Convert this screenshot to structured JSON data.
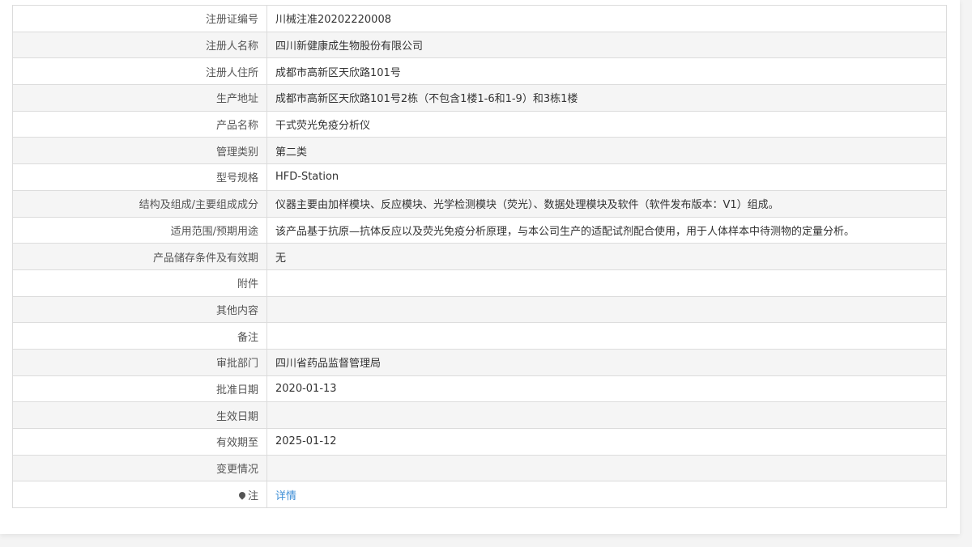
{
  "rows": [
    {
      "label": "注册证编号",
      "value": "川械注准20202220008"
    },
    {
      "label": "注册人名称",
      "value": "四川新健康成生物股份有限公司"
    },
    {
      "label": "注册人住所",
      "value": "成都市高新区天欣路101号"
    },
    {
      "label": "生产地址",
      "value": "成都市高新区天欣路101号2栋（不包含1楼1-6和1-9）和3栋1楼"
    },
    {
      "label": "产品名称",
      "value": "干式荧光免疫分析仪"
    },
    {
      "label": "管理类别",
      "value": "第二类"
    },
    {
      "label": "型号规格",
      "value": "HFD-Station"
    },
    {
      "label": "结构及组成/主要组成成分",
      "value": "仪器主要由加样模块、反应模块、光学检测模块（荧光）、数据处理模块及软件（软件发布版本：V1）组成。"
    },
    {
      "label": "适用范围/预期用途",
      "value": "该产品基于抗原—抗体反应以及荧光免疫分析原理，与本公司生产的适配试剂配合使用，用于人体样本中待测物的定量分析。"
    },
    {
      "label": "产品储存条件及有效期",
      "value": "无"
    },
    {
      "label": "附件",
      "value": ""
    },
    {
      "label": "其他内容",
      "value": ""
    },
    {
      "label": "备注",
      "value": ""
    },
    {
      "label": "审批部门",
      "value": "四川省药品监督管理局"
    },
    {
      "label": "批准日期",
      "value": "2020-01-13"
    },
    {
      "label": "生效日期",
      "value": ""
    },
    {
      "label": "有效期至",
      "value": "2025-01-12"
    },
    {
      "label": "变更情况",
      "value": ""
    }
  ],
  "note": {
    "label": "注",
    "link": "详情",
    "icon": "map-pin-icon"
  }
}
